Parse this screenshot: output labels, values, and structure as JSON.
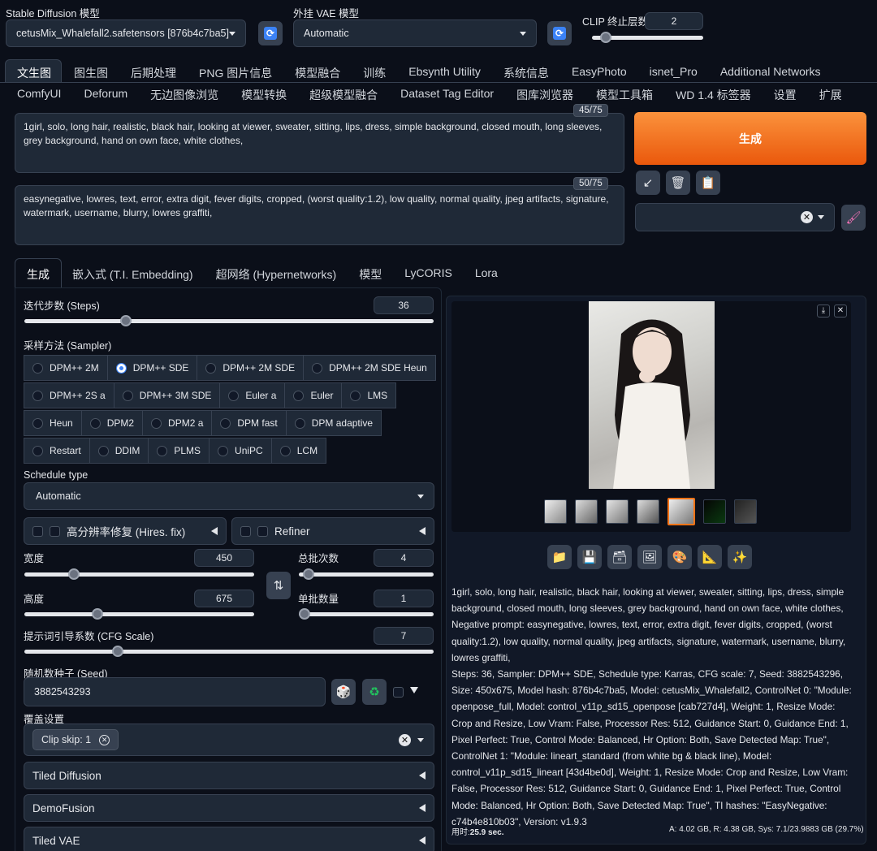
{
  "header": {
    "model_label": "Stable Diffusion 模型",
    "model_value": "cetusMix_Whalefall2.safetensors [876b4c7ba5]",
    "vae_label": "外挂 VAE 模型",
    "vae_value": "Automatic",
    "clip_label": "CLIP 终止层数",
    "clip_value": "2",
    "clip_fraction": 0.08
  },
  "tabs_row1": [
    "文生图",
    "图生图",
    "后期处理",
    "PNG 图片信息",
    "模型融合",
    "训练",
    "Ebsynth Utility",
    "系统信息",
    "EasyPhoto",
    "isnet_Pro",
    "Additional Networks"
  ],
  "tabs_row2": [
    "ComfyUI",
    "Deforum",
    "无边图像浏览",
    "模型转换",
    "超级模型融合",
    "Dataset Tag Editor",
    "图库浏览器",
    "模型工具箱",
    "WD 1.4 标签器",
    "设置",
    "扩展"
  ],
  "prompt": {
    "positive": "1girl, solo, long hair, realistic, black hair, looking at viewer, sweater, sitting, lips, dress, simple background, closed mouth, long sleeves, grey background, hand on own face, white clothes,",
    "positive_count": "45/75",
    "negative": "easynegative, lowres, text, error, extra digit, fever digits, cropped, (worst quality:1.2), low quality, normal quality, jpeg artifacts, signature, watermark, username, blurry, lowres graffiti,",
    "negative_count": "50/75"
  },
  "generate_label": "生成",
  "subtabs": [
    "生成",
    "嵌入式 (T.I. Embedding)",
    "超网络 (Hypernetworks)",
    "模型",
    "LyCORIS",
    "Lora"
  ],
  "steps": {
    "label": "迭代步数 (Steps)",
    "value": "36",
    "fraction": 0.24
  },
  "sampler": {
    "label": "采样方法 (Sampler)",
    "rows": [
      [
        "DPM++ 2M",
        "DPM++ SDE",
        "DPM++ 2M SDE",
        "DPM++ 2M SDE Heun"
      ],
      [
        "DPM++ 2S a",
        "DPM++ 3M SDE",
        "Euler a",
        "Euler",
        "LMS"
      ],
      [
        "Heun",
        "DPM2",
        "DPM2 a",
        "DPM fast",
        "DPM adaptive"
      ],
      [
        "Restart",
        "DDIM",
        "PLMS",
        "UniPC",
        "LCM"
      ]
    ],
    "selected": "DPM++ SDE"
  },
  "schedule": {
    "label": "Schedule type",
    "value": "Automatic"
  },
  "hires": {
    "label": "高分辨率修复 (Hires. fix)"
  },
  "refiner": {
    "label": "Refiner"
  },
  "width": {
    "label": "宽度",
    "value": "450",
    "fraction": 0.2
  },
  "height": {
    "label": "高度",
    "value": "675",
    "fraction": 0.31
  },
  "batch_count": {
    "label": "总批次数",
    "value": "4",
    "fraction": 0.03
  },
  "batch_size": {
    "label": "单批数量",
    "value": "1",
    "fraction": 0.0
  },
  "cfg": {
    "label": "提示词引导系数 (CFG Scale)",
    "value": "7",
    "fraction": 0.22
  },
  "seed": {
    "label": "随机数种子 (Seed)",
    "value": "3882543293"
  },
  "override": {
    "label": "覆盖设置",
    "chip": "Clip skip: 1"
  },
  "accordions": [
    "Tiled Diffusion",
    "DemoFusion",
    "Tiled VAE"
  ],
  "info_text": "1girl, solo, long hair, realistic, black hair, looking at viewer, sweater, sitting, lips, dress, simple background, closed mouth, long sleeves, grey background, hand on own face, white clothes,\nNegative prompt: easynegative, lowres, text, error, extra digit, fever digits, cropped, (worst quality:1.2), low quality, normal quality, jpeg artifacts, signature, watermark, username, blurry, lowres graffiti,\nSteps: 36, Sampler: DPM++ SDE, Schedule type: Karras, CFG scale: 7, Seed: 3882543296, Size: 450x675, Model hash: 876b4c7ba5, Model: cetusMix_Whalefall2, ControlNet 0: \"Module: openpose_full, Model: control_v11p_sd15_openpose [cab727d4], Weight: 1, Resize Mode: Crop and Resize, Low Vram: False, Processor Res: 512, Guidance Start: 0, Guidance End: 1, Pixel Perfect: True, Control Mode: Balanced, Hr Option: Both, Save Detected Map: True\", ControlNet 1: \"Module: lineart_standard (from white bg & black line), Model: control_v11p_sd15_lineart [43d4be0d], Weight: 1, Resize Mode: Crop and Resize, Low Vram: False, Processor Res: 512, Guidance Start: 0, Guidance End: 1, Pixel Perfect: True, Control Mode: Balanced, Hr Option: Both, Save Detected Map: True\", TI hashes: \"EasyNegative: c74b4e810b03\", Version: v1.9.3",
  "footer": {
    "time_label": "用时:",
    "time_value": "25.9 sec.",
    "mem": "A: 4.02 GB, R: 4.38 GB, Sys: 7.1/23.9883 GB (29.7%)"
  },
  "colors": {
    "accent": "#f97316",
    "selected_thumb": "#f97316",
    "radio_on": "#3b82f6"
  }
}
